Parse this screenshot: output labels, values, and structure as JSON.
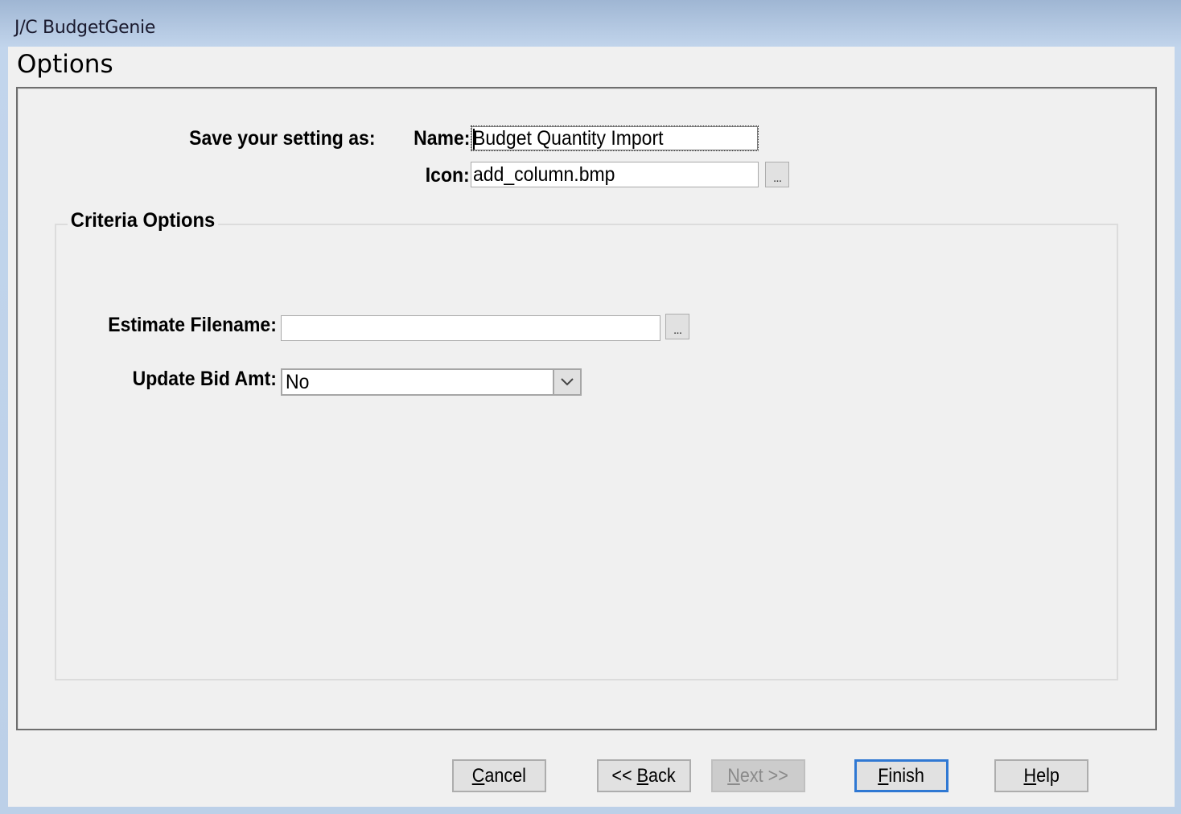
{
  "window": {
    "title": "J/C BudgetGenie"
  },
  "page": {
    "heading": "Options"
  },
  "save_settings": {
    "label": "Save your setting as:",
    "name_label": "Name:",
    "name_value": "Budget Quantity Import",
    "icon_label": "Icon:",
    "icon_value": "add_column.bmp",
    "browse_label": "..."
  },
  "criteria": {
    "legend": "Criteria Options",
    "estimate_filename_label": "Estimate Filename:",
    "estimate_filename_value": "",
    "browse_label": "...",
    "update_bid_label": "Update Bid Amt:",
    "update_bid_value": "No"
  },
  "buttons": {
    "cancel": {
      "mnemonic": "C",
      "rest": "ancel"
    },
    "back": {
      "prefix": "<< ",
      "mnemonic": "B",
      "rest": "ack"
    },
    "next": {
      "mnemonic": "N",
      "rest": "ext >>"
    },
    "finish": {
      "mnemonic": "F",
      "rest": "inish"
    },
    "help": {
      "mnemonic": "H",
      "rest": "elp"
    }
  },
  "colors": {
    "default_button_border": "#2f78d3",
    "title_bar": "#bcd0e8",
    "dialog_bg": "#f0f0f0"
  }
}
